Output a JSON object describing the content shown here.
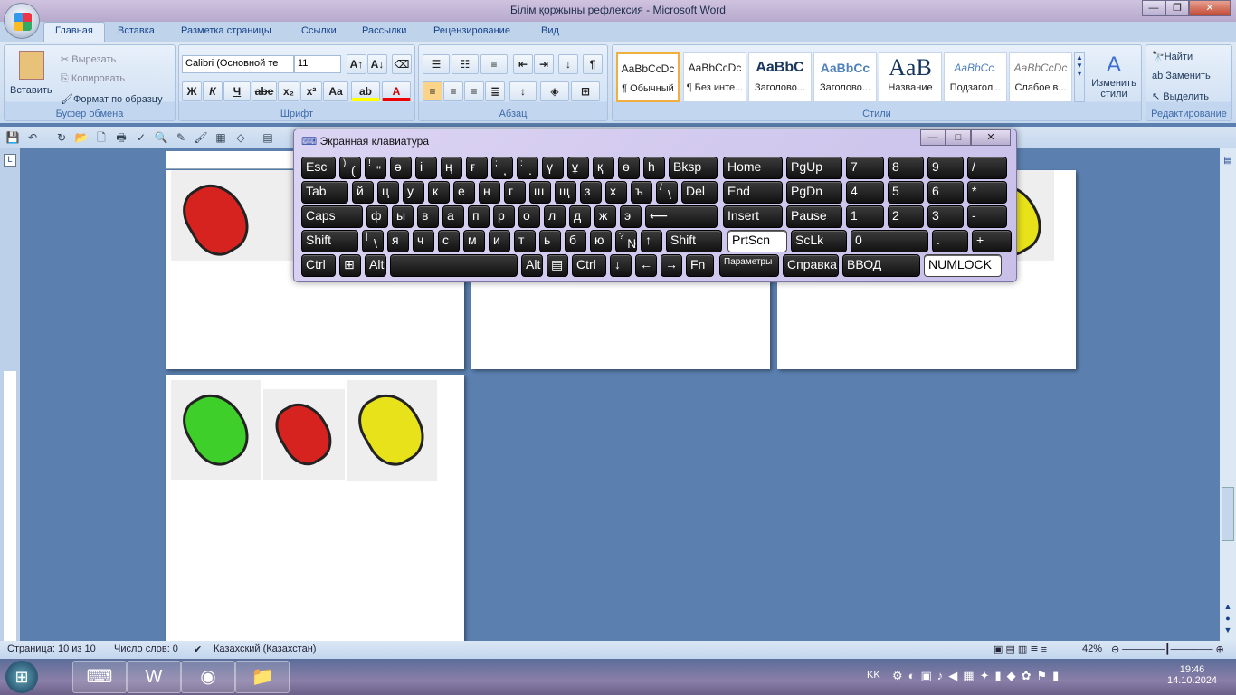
{
  "window": {
    "title": "Білім қоржыны рефлексия - Microsoft Word",
    "min": "—",
    "max": "❐",
    "close": "✕"
  },
  "tabs": [
    "Главная",
    "Вставка",
    "Разметка страницы",
    "Ссылки",
    "Рассылки",
    "Рецензирование",
    "Вид"
  ],
  "ribbon": {
    "clipboard": {
      "label": "Буфер обмена",
      "paste": "Вставить",
      "cut": "Вырезать",
      "copy": "Копировать",
      "format": "Формат по образцу"
    },
    "font": {
      "label": "Шрифт",
      "name": "Calibri (Основной те",
      "size": "11",
      "bold": "Ж",
      "italic": "К",
      "underline": "Ч",
      "strike": "abe",
      "sub": "x₂",
      "sup": "x²",
      "case": "Aa",
      "grow": "A↑",
      "shrink": "A↓"
    },
    "paragraph": {
      "label": "Абзац",
      "pilcrow": "¶"
    },
    "styles": {
      "label": "Стили",
      "items": [
        {
          "preview": "AaBbCcDc",
          "name": "¶ Обычный"
        },
        {
          "preview": "AaBbCcDc",
          "name": "¶ Без инте..."
        },
        {
          "preview": "AaBbC",
          "name": "Заголово..."
        },
        {
          "preview": "AaBbCc",
          "name": "Заголово..."
        },
        {
          "preview": "AaB",
          "name": "Название"
        },
        {
          "preview": "AaBbCc.",
          "name": "Подзагол..."
        },
        {
          "preview": "AaBbCcDc",
          "name": "Слабое в..."
        }
      ],
      "change": "Изменить стили"
    },
    "editing": {
      "label": "Редактирование",
      "find": "Найти",
      "replace": "Заменить",
      "select": "Выделить"
    }
  },
  "osk": {
    "title": "Экранная клавиатура",
    "min": "—",
    "max": "□",
    "close": "✕",
    "rows": [
      [
        {
          "l": "Esc"
        },
        {
          "s": ")",
          "l": "("
        },
        {
          "s": "!",
          "l": "\""
        },
        {
          "l": "ә"
        },
        {
          "l": "і"
        },
        {
          "l": "ң"
        },
        {
          "l": "ғ"
        },
        {
          "s": ";",
          "l": ","
        },
        {
          "s": ":",
          "l": "."
        },
        {
          "l": "ү"
        },
        {
          "l": "ұ"
        },
        {
          "l": "қ"
        },
        {
          "l": "ө"
        },
        {
          "l": "h"
        },
        {
          "l": "Bksp"
        },
        {
          "l": "Home"
        },
        {
          "l": "PgUp"
        },
        {
          "l": "7"
        },
        {
          "l": "8"
        },
        {
          "l": "9"
        },
        {
          "l": "/"
        }
      ],
      [
        {
          "l": "Tab"
        },
        {
          "l": "й"
        },
        {
          "l": "ц"
        },
        {
          "l": "у"
        },
        {
          "l": "к"
        },
        {
          "l": "е"
        },
        {
          "l": "н"
        },
        {
          "l": "г"
        },
        {
          "l": "ш"
        },
        {
          "l": "щ"
        },
        {
          "l": "з"
        },
        {
          "l": "х"
        },
        {
          "l": "ъ"
        },
        {
          "s": "/",
          "l": "\\"
        },
        {
          "l": "Del"
        },
        {
          "l": "End"
        },
        {
          "l": "PgDn"
        },
        {
          "l": "4"
        },
        {
          "l": "5"
        },
        {
          "l": "6"
        },
        {
          "l": "*"
        }
      ],
      [
        {
          "l": "Caps"
        },
        {
          "l": "ф"
        },
        {
          "l": "ы"
        },
        {
          "l": "в"
        },
        {
          "l": "а"
        },
        {
          "l": "п"
        },
        {
          "l": "р"
        },
        {
          "l": "о"
        },
        {
          "l": "л"
        },
        {
          "l": "д"
        },
        {
          "l": "ж"
        },
        {
          "l": "э"
        },
        {
          "l": "⟵"
        },
        {
          "l": "Insert"
        },
        {
          "l": "Pause"
        },
        {
          "l": "1"
        },
        {
          "l": "2"
        },
        {
          "l": "3"
        },
        {
          "l": "-"
        }
      ],
      [
        {
          "l": "Shift"
        },
        {
          "s": "|",
          "l": "\\"
        },
        {
          "l": "я"
        },
        {
          "l": "ч"
        },
        {
          "l": "с"
        },
        {
          "l": "м"
        },
        {
          "l": "и"
        },
        {
          "l": "т"
        },
        {
          "l": "ь"
        },
        {
          "l": "б"
        },
        {
          "l": "ю"
        },
        {
          "s": "?",
          "l": "№"
        },
        {
          "l": "↑"
        },
        {
          "l": "Shift"
        },
        {
          "l": "PrtScn"
        },
        {
          "l": "ScLk"
        },
        {
          "l": "0"
        },
        {
          "l": "."
        },
        {
          "l": "+"
        }
      ],
      [
        {
          "l": "Ctrl"
        },
        {
          "l": "⊞"
        },
        {
          "l": "Alt"
        },
        {
          "l": ""
        },
        {
          "l": "Alt"
        },
        {
          "l": "▤"
        },
        {
          "l": "Ctrl"
        },
        {
          "l": "↓"
        },
        {
          "l": "←"
        },
        {
          "l": "→"
        },
        {
          "l": "Fn"
        },
        {
          "l": "Параметры"
        },
        {
          "l": "Справка"
        },
        {
          "l": "ВВОД"
        },
        {
          "l": "NUMLOCK"
        }
      ]
    ]
  },
  "status": {
    "page": "Страница: 10 из 10",
    "words": "Число слов: 0",
    "lang": "Казахский (Казахстан)",
    "zoom": "42%"
  },
  "tray": {
    "lang": "KK",
    "time": "19:46",
    "date": "14.10.2024"
  }
}
